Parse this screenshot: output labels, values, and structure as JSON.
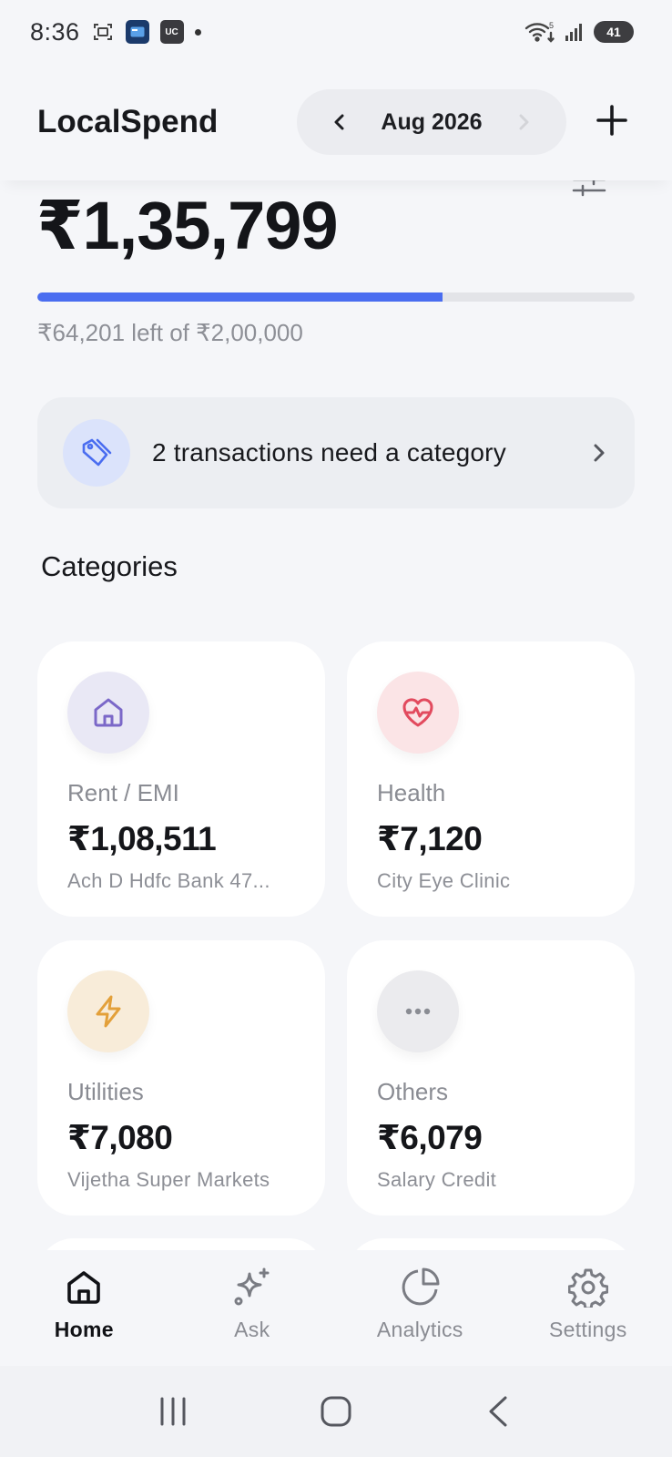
{
  "status_bar": {
    "time": "8:36",
    "app_badge": "UC",
    "battery": "41",
    "network_tag": "5"
  },
  "header": {
    "title": "LocalSpend",
    "month": "Aug 2026"
  },
  "summary": {
    "spent": "₹1,35,799",
    "budget_text": "₹64,201 left of ₹2,00,000",
    "progress_fraction": 0.679,
    "accent_color": "#4a6df0"
  },
  "banner": {
    "text": "2 transactions need a category"
  },
  "categories": {
    "title": "Categories",
    "items": [
      {
        "label": "Rent / EMI",
        "amount": "₹1,08,511",
        "sub": "Ach D Hdfc Bank 47...",
        "icon": "home-icon",
        "color": "#7b68c8"
      },
      {
        "label": "Health",
        "amount": "₹7,120",
        "sub": "City Eye Clinic",
        "icon": "heart-pulse-icon",
        "color": "#e24a5e"
      },
      {
        "label": "Utilities",
        "amount": "₹7,080",
        "sub": "Vijetha Super Markets",
        "icon": "lightning-icon",
        "color": "#e3a03a"
      },
      {
        "label": "Others",
        "amount": "₹6,079",
        "sub": "Salary Credit",
        "icon": "more-dots-icon",
        "color": "#8a8c93"
      }
    ]
  },
  "nav": {
    "items": [
      {
        "label": "Home",
        "icon": "home-icon",
        "active": true
      },
      {
        "label": "Ask",
        "icon": "sparkle-icon",
        "active": false
      },
      {
        "label": "Analytics",
        "icon": "pie-chart-icon",
        "active": false
      },
      {
        "label": "Settings",
        "icon": "gear-icon",
        "active": false
      }
    ]
  }
}
